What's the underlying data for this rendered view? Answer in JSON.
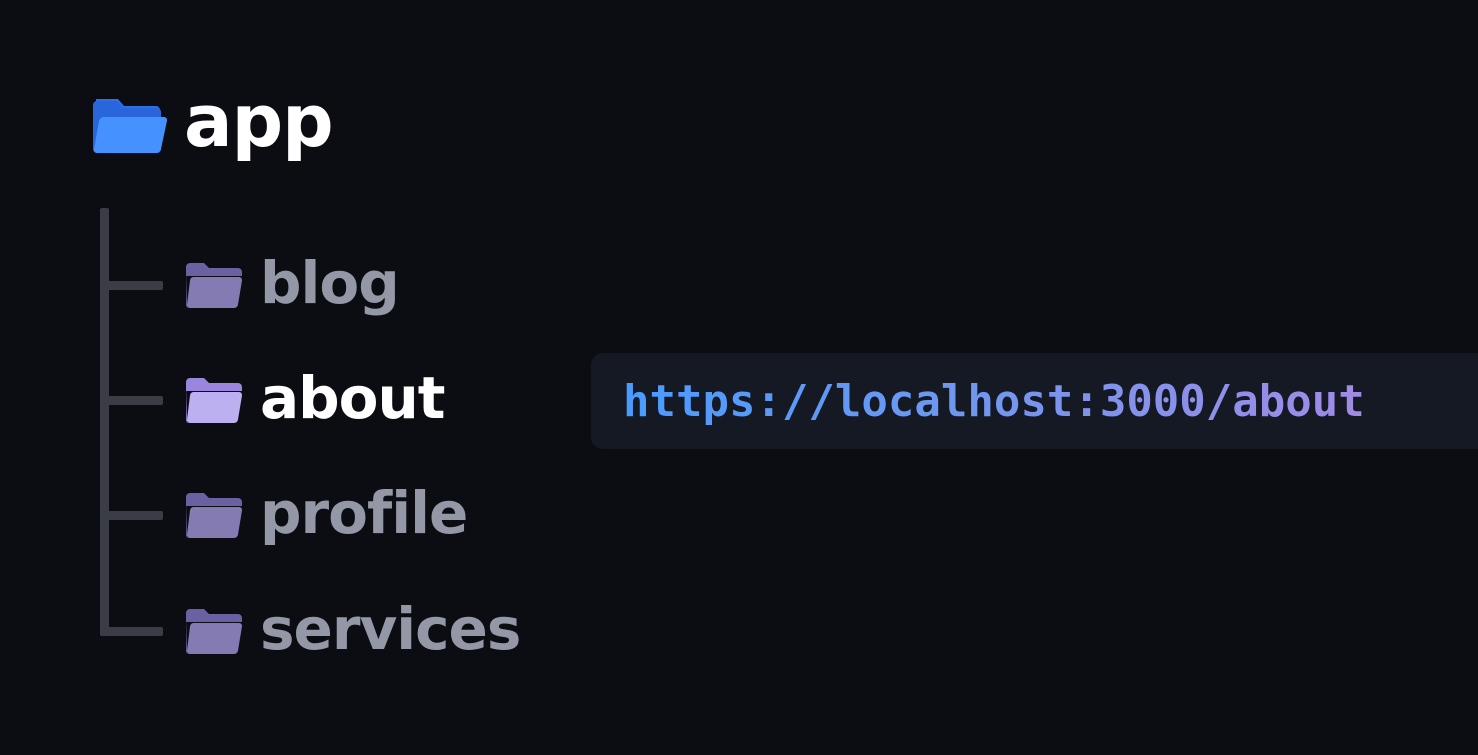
{
  "root": {
    "label": "app",
    "icon": "folder-open-icon",
    "icon_color": "#3d8bff"
  },
  "children": [
    {
      "label": "blog",
      "icon": "folder-icon",
      "active": false
    },
    {
      "label": "about",
      "icon": "folder-icon",
      "active": true
    },
    {
      "label": "profile",
      "icon": "folder-icon",
      "active": false
    },
    {
      "label": "services",
      "icon": "folder-icon",
      "active": false
    }
  ],
  "url": {
    "text": "https://localhost:3000/about"
  },
  "colors": {
    "background": "#0b0d12",
    "tree_line": "#3a3d46",
    "folder_inactive": "#7d73b3",
    "folder_active": "#b3a4ea",
    "label_inactive": "#9497a6",
    "label_active": "#ffffff",
    "url_start": "#4a9bff",
    "url_end": "#a08be6"
  }
}
